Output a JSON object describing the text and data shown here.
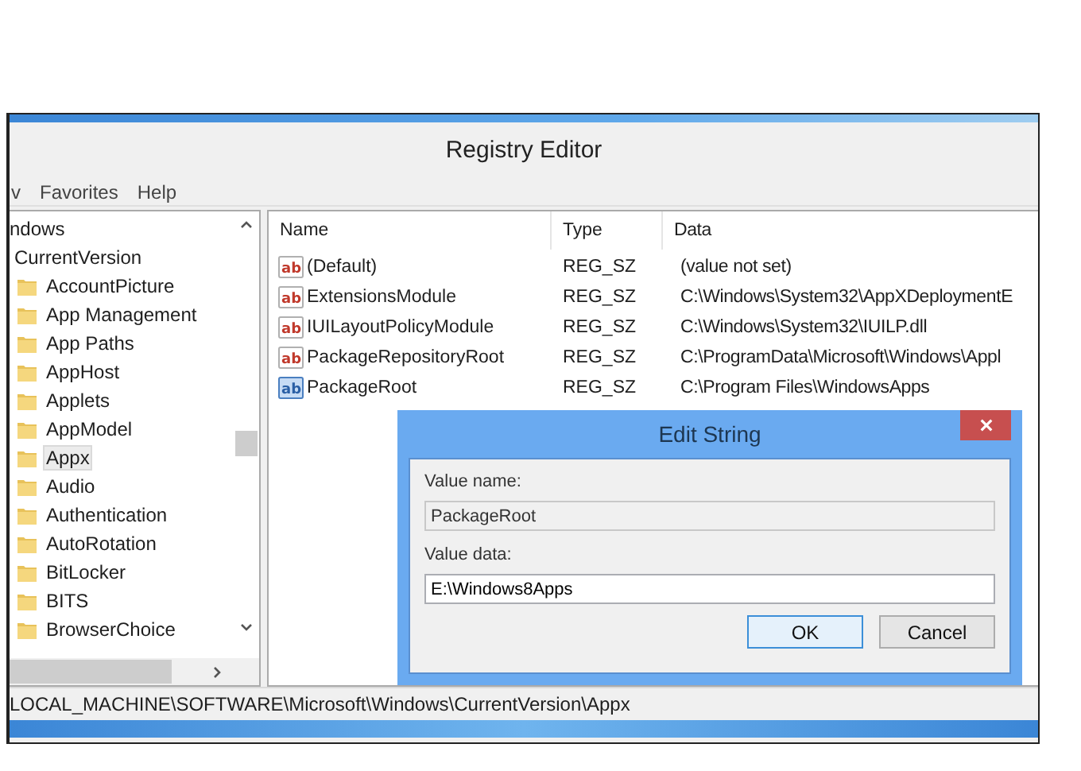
{
  "window": {
    "title": "Registry Editor"
  },
  "menu": [
    "v",
    "Favorites",
    "Help"
  ],
  "tree": {
    "label": "ndows",
    "children": [
      {
        "label": "CurrentVersion",
        "children": [
          {
            "label": "AccountPicture",
            "selected": false
          },
          {
            "label": "App Management",
            "selected": false
          },
          {
            "label": "App Paths",
            "selected": false
          },
          {
            "label": "AppHost",
            "selected": false
          },
          {
            "label": "Applets",
            "selected": false
          },
          {
            "label": "AppModel",
            "selected": false
          },
          {
            "label": "Appx",
            "selected": true
          },
          {
            "label": "Audio",
            "selected": false
          },
          {
            "label": "Authentication",
            "selected": false
          },
          {
            "label": "AutoRotation",
            "selected": false
          },
          {
            "label": "BitLocker",
            "selected": false
          },
          {
            "label": "BITS",
            "selected": false
          },
          {
            "label": "BrowserChoice",
            "selected": false
          }
        ]
      }
    ]
  },
  "table": {
    "columns": [
      "Name",
      "Type",
      "Data"
    ],
    "rows": [
      {
        "icon": "ab",
        "name": "(Default)",
        "type": "REG_SZ",
        "data": "(value not set)",
        "selected": false
      },
      {
        "icon": "ab",
        "name": "ExtensionsModule",
        "type": "REG_SZ",
        "data": "C:\\Windows\\System32\\AppXDeploymentE",
        "selected": false
      },
      {
        "icon": "ab",
        "name": "IUILayoutPolicyModule",
        "type": "REG_SZ",
        "data": "C:\\Windows\\System32\\IUILP.dll",
        "selected": false
      },
      {
        "icon": "ab",
        "name": "PackageRepositoryRoot",
        "type": "REG_SZ",
        "data": "C:\\ProgramData\\Microsoft\\Windows\\Appl",
        "selected": false
      },
      {
        "icon": "ab",
        "name": "PackageRoot",
        "type": "REG_SZ",
        "data": "C:\\Program Files\\WindowsApps",
        "selected": true
      }
    ]
  },
  "dialog": {
    "title": "Edit String",
    "value_name_label": "Value name:",
    "value_name": "PackageRoot",
    "value_data_label": "Value data:",
    "value_data": "E:\\Windows8Apps",
    "buttons": [
      {
        "label": "OK",
        "default": true
      },
      {
        "label": "Cancel",
        "default": false
      }
    ]
  },
  "status_bar": "LOCAL_MACHINE\\SOFTWARE\\Microsoft\\Windows\\CurrentVersion\\Appx"
}
